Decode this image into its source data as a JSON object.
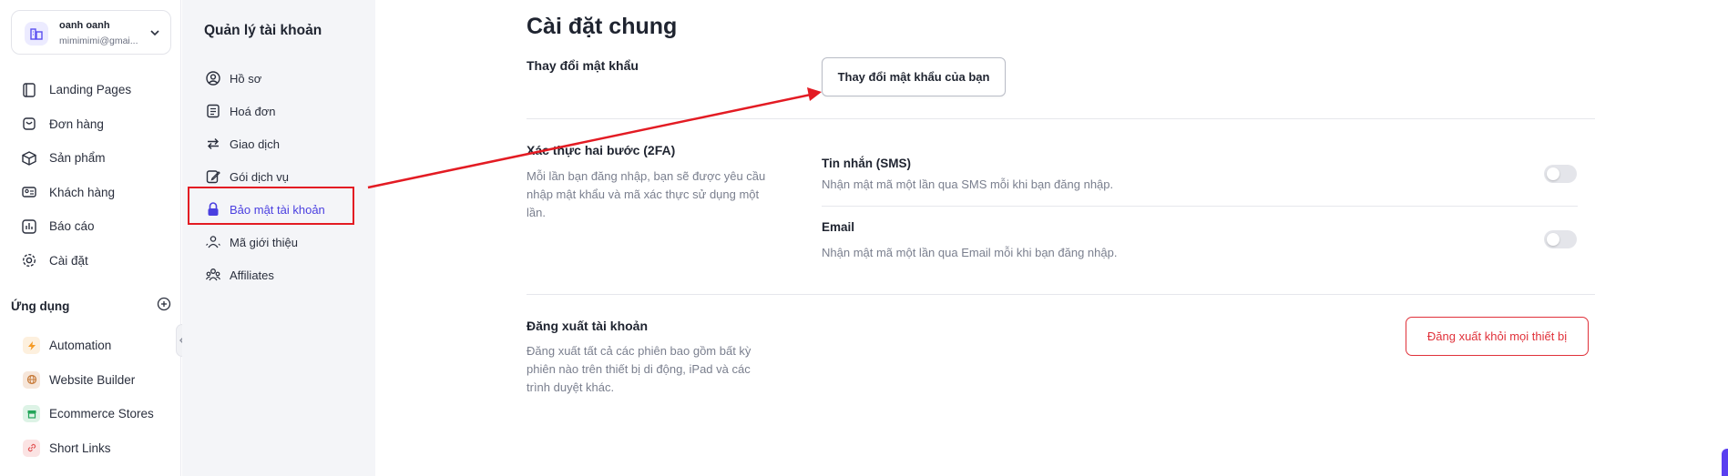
{
  "account": {
    "name": "oanh oanh",
    "email": "mimimimi@gmai..."
  },
  "nav": [
    {
      "label": "Landing Pages",
      "icon": "landing-pages-icon"
    },
    {
      "label": "Đơn hàng",
      "icon": "orders-icon"
    },
    {
      "label": "Sản phẩm",
      "icon": "products-icon"
    },
    {
      "label": "Khách hàng",
      "icon": "customers-icon"
    },
    {
      "label": "Báo cáo",
      "icon": "reports-icon"
    },
    {
      "label": "Cài đặt",
      "icon": "settings-icon"
    }
  ],
  "apps": {
    "title": "Ứng dụng",
    "items": [
      {
        "label": "Automation",
        "icon": "automation-icon",
        "color": "#f59a23"
      },
      {
        "label": "Website Builder",
        "icon": "website-builder-icon",
        "color": "#c77b3a"
      },
      {
        "label": "Ecommerce Stores",
        "icon": "ecommerce-stores-icon",
        "color": "#22a559"
      },
      {
        "label": "Short Links",
        "icon": "short-links-icon",
        "color": "#e25555"
      }
    ]
  },
  "account_menu": {
    "title": "Quản lý tài khoản",
    "items": [
      {
        "label": "Hồ sơ",
        "icon": "profile-icon"
      },
      {
        "label": "Hoá đơn",
        "icon": "invoice-icon"
      },
      {
        "label": "Giao dịch",
        "icon": "transactions-icon"
      },
      {
        "label": "Gói dịch vụ",
        "icon": "service-plan-icon"
      },
      {
        "label": "Bảo mật tài khoản",
        "icon": "lock-icon",
        "active": true
      },
      {
        "label": "Mã giới thiệu",
        "icon": "referral-icon"
      },
      {
        "label": "Affiliates",
        "icon": "affiliates-icon"
      }
    ]
  },
  "main": {
    "title": "Cài đặt chung",
    "password": {
      "label": "Thay đổi mật khẩu",
      "button": "Thay đổi mật khẩu của bạn"
    },
    "twofa": {
      "label": "Xác thực hai bước (2FA)",
      "desc": "Mỗi lần bạn đăng nhập, bạn sẽ được yêu cầu nhập mật khẩu và mã xác thực sử dụng một lần.",
      "options": [
        {
          "title": "Tin nhắn (SMS)",
          "desc": "Nhận mật mã một lần qua SMS mỗi khi bạn đăng nhập.",
          "enabled": false
        },
        {
          "title": "Email",
          "desc": "Nhận mật mã một lần qua Email mỗi khi bạn đăng nhập.",
          "enabled": false
        }
      ]
    },
    "logout": {
      "label": "Đăng xuất tài khoản",
      "desc": "Đăng xuất tất cả các phiên bao gồm bất kỳ phiên nào trên thiết bị di động, iPad và các trình duyệt khác.",
      "button": "Đăng xuất khỏi mọi thiết bị"
    }
  },
  "colors": {
    "accent": "#4a3fe0",
    "danger": "#e0313a",
    "annotation": "#e31b23"
  }
}
